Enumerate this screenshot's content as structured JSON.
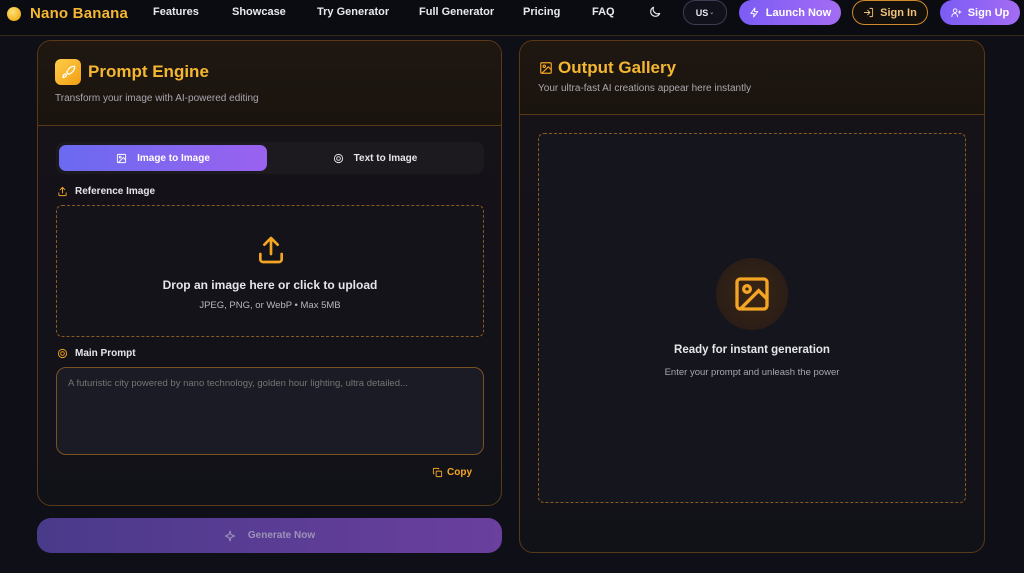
{
  "nav": {
    "brand": "Nano Banana",
    "links": [
      "Features",
      "Showcase",
      "Try Generator",
      "Full Generator",
      "Pricing",
      "FAQ"
    ],
    "language": "US",
    "launch_label": "Launch Now",
    "signin_label": "Sign In",
    "signup_label": "Sign Up"
  },
  "prompt_engine": {
    "title": "Prompt Engine",
    "subtitle": "Transform your image with AI-powered editing",
    "tabs": [
      {
        "label": "Image to Image",
        "active": true
      },
      {
        "label": "Text to Image",
        "active": false
      }
    ],
    "reference_label": "Reference Image",
    "drop_title": "Drop an image here or click to upload",
    "drop_sub": "JPEG, PNG, or WebP • Max 5MB",
    "main_prompt_label": "Main Prompt",
    "prompt_placeholder": "A futuristic city powered by nano technology, golden hour lighting, ultra detailed...",
    "copy_label": "Copy",
    "generate_label": "Generate Now"
  },
  "gallery": {
    "title": "Output Gallery",
    "subtitle": "Your ultra-fast AI creations appear here instantly",
    "ready_title": "Ready for instant generation",
    "ready_sub": "Enter your prompt and unleash the power"
  },
  "colors": {
    "accent": "#f5b731",
    "purple": "#7b5cf5",
    "border": "#5a3a16",
    "background": "#0e0f17"
  },
  "icons": [
    "logo-dot-icon",
    "moon-icon",
    "chevron-down-icon",
    "lightning-icon",
    "sign-in-icon",
    "user-plus-icon",
    "rocket-icon",
    "image-icon",
    "target-icon",
    "upload-icon",
    "copy-icon",
    "sparkle-icon"
  ]
}
